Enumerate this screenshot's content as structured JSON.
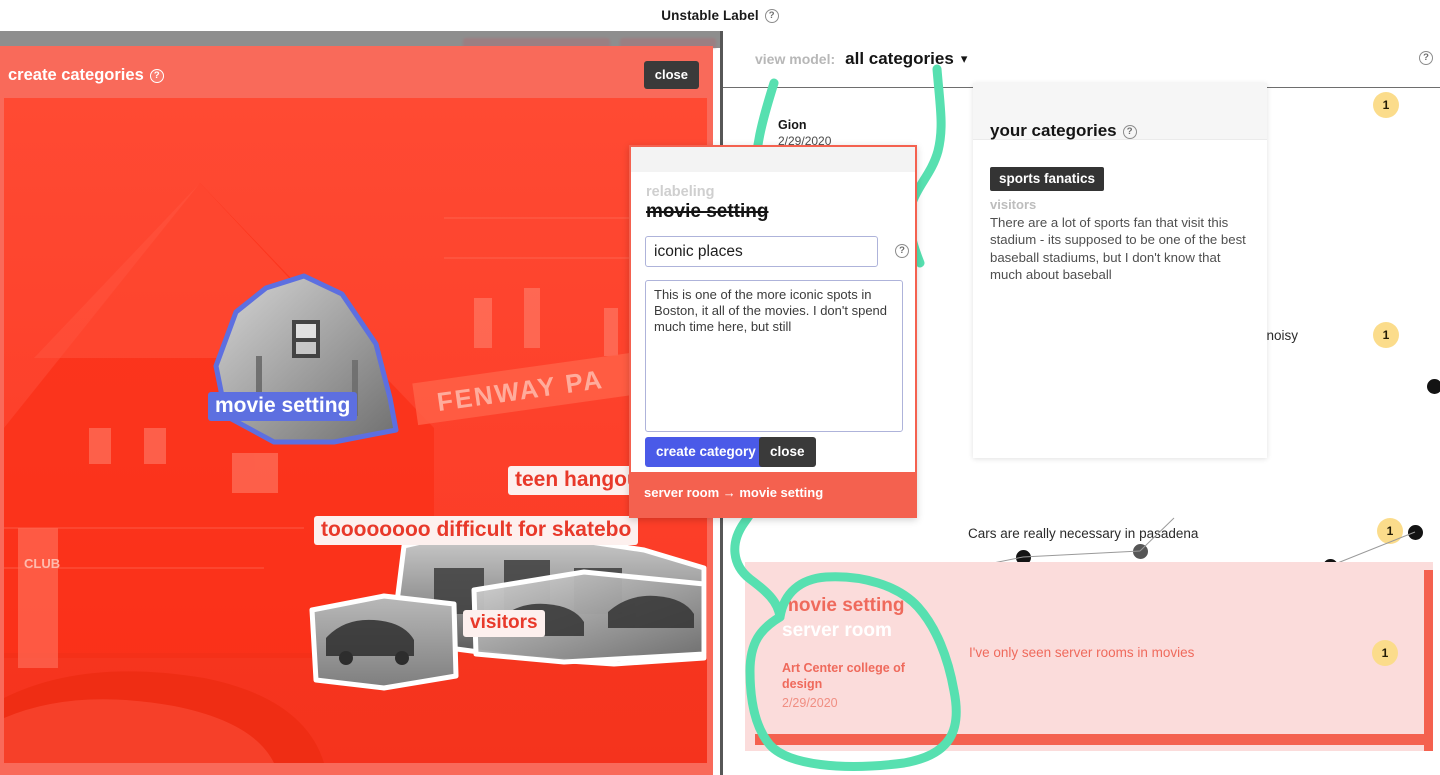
{
  "app": {
    "title": "Unstable Label",
    "help_icon": "question-mark-icon"
  },
  "workspace": {
    "toolbar": {
      "view_model_label": "view model:",
      "view_model_value": "all categories",
      "caret": "⌄",
      "help_icon": "question-mark-icon"
    },
    "rows": [
      {
        "title": "Gion",
        "date": "2/29/2020",
        "text": "",
        "badge": "1"
      },
      {
        "title": "",
        "date": "",
        "text": "em noisy",
        "badge": "1"
      },
      {
        "title": "",
        "date": "",
        "text": "Cars are really necessary in pasadena",
        "badge": "1"
      },
      {
        "title": "",
        "date": "2/29/2020",
        "text": "",
        "badge": ""
      }
    ],
    "pink_card": {
      "category": "movie setting",
      "old_category": "server room",
      "source": "Art Center college of design",
      "date": "2/29/2020",
      "note": "I've only seen server rooms in movies",
      "badge": "1"
    }
  },
  "categories_panel": {
    "title": "your categories",
    "help_icon": "question-mark-icon",
    "items": [
      {
        "chip": "sports fanatics",
        "subtitle": "visitors",
        "description": "There are a lot of sports fan that visit this stadium - its supposed to be one of the best baseball stadiums, but I don't know that much about baseball"
      }
    ]
  },
  "left_panel": {
    "title": "create categories",
    "help_icon": "question-mark-icon",
    "close_label": "close",
    "annotations": [
      {
        "label": "movie setting",
        "style": "blue"
      },
      {
        "label": "teen hangou",
        "style": "white"
      },
      {
        "label": "toooooooo difficult for skatebo",
        "style": "white"
      },
      {
        "label": "visitors",
        "style": "white"
      }
    ]
  },
  "relabel_modal": {
    "kicker": "relabeling",
    "old_label": "movie setting",
    "name_value": "iconic places",
    "name_placeholder": "category name",
    "name_help_icon": "question-mark-icon",
    "description_value": "This is one of the more iconic spots in Boston, it all of the movies. I don't spend much time here, but still ",
    "description_placeholder": "description",
    "create_label": "create category",
    "close_label": "close",
    "footer": "server room → movie setting"
  },
  "colors": {
    "accent_red": "#f4614f",
    "panel_red": "#f96a5a",
    "photo_red": "#fb3b24",
    "blue_tag": "#5d6fe0",
    "create_blue": "#4a5ae8",
    "badge_yellow": "#fbdc8b",
    "highlighter_green": "#57e0b0",
    "dark_chip": "#343434",
    "pink_card": "#fbdcdb"
  }
}
